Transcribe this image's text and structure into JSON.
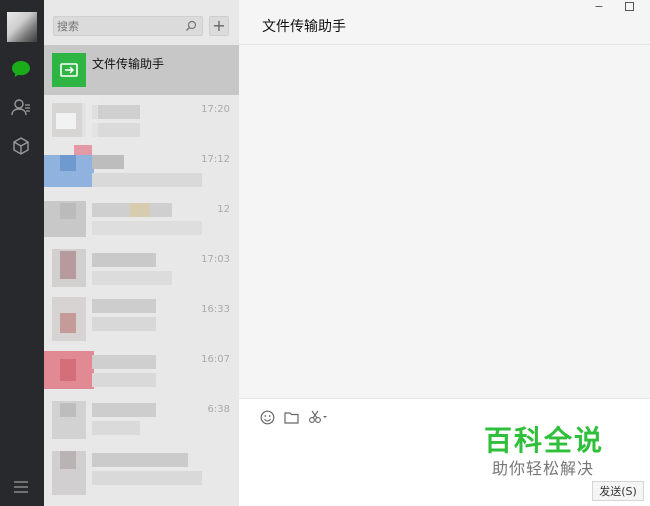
{
  "search": {
    "placeholder": "搜索"
  },
  "add_label": "+",
  "active_chat": {
    "name": "文件传输助手",
    "accent": "#2fb544"
  },
  "chats": [
    {
      "time": "17:20"
    },
    {
      "time": "17:12"
    },
    {
      "time": "12"
    },
    {
      "time": "17:03"
    },
    {
      "time": "16:33"
    },
    {
      "time": "16:07"
    },
    {
      "time": "6:38"
    },
    {
      "time": ""
    }
  ],
  "header": {
    "title": "文件传输助手",
    "minimize_label": "−"
  },
  "composer": {
    "send_label": "发送(S)"
  },
  "watermark": {
    "title": "百科全说",
    "subtitle": "助你轻松解决",
    "color": "#2fbf3a"
  },
  "icons": {
    "nav": [
      "chat-icon",
      "contacts-icon",
      "favorites-icon",
      "menu-icon"
    ],
    "toolbar": [
      "emoji-icon",
      "folder-icon",
      "scissors-icon"
    ]
  }
}
